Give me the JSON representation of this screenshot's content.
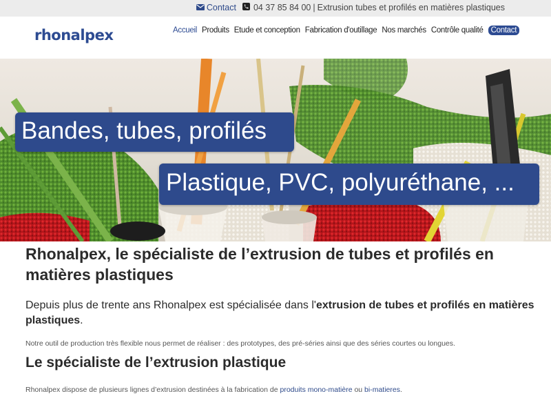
{
  "topbar": {
    "contact_label": "Contact",
    "phone": "04 37 85 84 00",
    "tagline": "Extrusion tubes et profilés en matières plastiques",
    "separator": "|"
  },
  "header": {
    "logo": "rhonalpex",
    "nav": {
      "accueil": "Accueil",
      "produits": "Produits",
      "etude": "Etude et conception",
      "fabrication": "Fabrication d'outillage",
      "marches": "Nos marchés",
      "controle": "Contrôle qualité",
      "contact": "Contact"
    }
  },
  "hero": {
    "banner1": "Bandes, tubes, profilés",
    "banner2": "Plastique, PVC, polyuréthane, ..."
  },
  "content": {
    "title": "Rhonalpex, le spécialiste de l’extrusion de tubes et profilés en matières plastiques",
    "lead_prefix": "Depuis plus de trente ans Rhonalpex est spécialisée dans l'",
    "lead_bold": "extrusion de tubes et profilés en matières plastiques",
    "lead_suffix": ".",
    "paragraph1": "Notre outil de production très flexible nous permet de réaliser : des prototypes, des pré-séries ainsi que des séries courtes ou longues.",
    "subtitle": "Le spécialiste de l’extrusion plastique",
    "p2_prefix": "Rhonalpex dispose de plusieurs lignes d’extrusion destinées à la fabrication de ",
    "p2_link1": "produits mono-matière",
    "p2_mid": " ou ",
    "p2_link2": "bi-matieres",
    "p2_suffix": "."
  },
  "colors": {
    "brand": "#2d4b92",
    "topbar_bg": "#ececec"
  },
  "icons": {
    "contact": "envelope-icon",
    "phone": "phone-icon"
  }
}
